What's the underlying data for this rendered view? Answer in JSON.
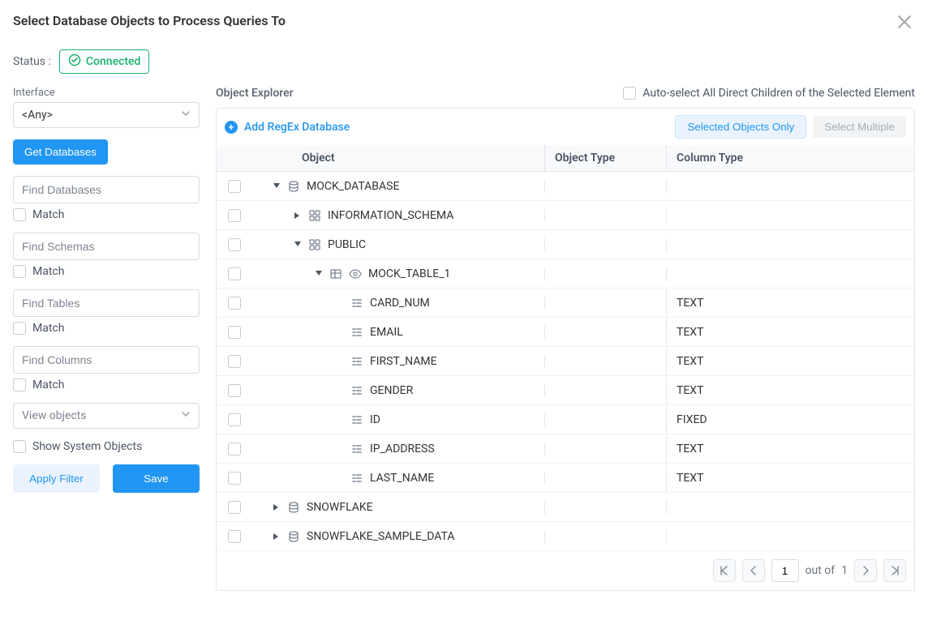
{
  "dialog": {
    "title": "Select Database Objects to Process Queries To"
  },
  "status": {
    "label": "Status :",
    "value": "Connected"
  },
  "sidebar": {
    "interface_label": "Interface",
    "interface_value": "<Any>",
    "get_databases": "Get Databases",
    "find_db_placeholder": "Find Databases",
    "find_schema_placeholder": "Find Schemas",
    "find_table_placeholder": "Find Tables",
    "find_column_placeholder": "Find Columns",
    "match_label": "Match",
    "view_objects": "View objects",
    "show_system_objects": "Show System Objects",
    "apply_filter": "Apply Filter",
    "save": "Save"
  },
  "explorer": {
    "title": "Object Explorer",
    "auto_select_label": "Auto-select All Direct Children of the Selected Element",
    "add_regex": "Add RegEx Database",
    "selected_only": "Selected Objects Only",
    "select_multiple": "Select Multiple",
    "columns": {
      "object": "Object",
      "object_type": "Object Type",
      "column_type": "Column Type"
    }
  },
  "rows": [
    {
      "level": 1,
      "expander": "down",
      "icon": "db",
      "name": "MOCK_DATABASE",
      "object_type": "",
      "column_type": ""
    },
    {
      "level": 2,
      "expander": "right",
      "icon": "schema",
      "name": "INFORMATION_SCHEMA",
      "object_type": "",
      "column_type": ""
    },
    {
      "level": 2,
      "expander": "down",
      "icon": "schema",
      "name": "PUBLIC",
      "object_type": "",
      "column_type": ""
    },
    {
      "level": 3,
      "expander": "down",
      "icon": "table_eye",
      "name": "MOCK_TABLE_1",
      "object_type": "",
      "column_type": ""
    },
    {
      "level": 4,
      "expander": "none",
      "icon": "col",
      "name": "CARD_NUM",
      "object_type": "",
      "column_type": "TEXT"
    },
    {
      "level": 4,
      "expander": "none",
      "icon": "col",
      "name": "EMAIL",
      "object_type": "",
      "column_type": "TEXT"
    },
    {
      "level": 4,
      "expander": "none",
      "icon": "col",
      "name": "FIRST_NAME",
      "object_type": "",
      "column_type": "TEXT"
    },
    {
      "level": 4,
      "expander": "none",
      "icon": "col",
      "name": "GENDER",
      "object_type": "",
      "column_type": "TEXT"
    },
    {
      "level": 4,
      "expander": "none",
      "icon": "col",
      "name": "ID",
      "object_type": "",
      "column_type": "FIXED"
    },
    {
      "level": 4,
      "expander": "none",
      "icon": "col",
      "name": "IP_ADDRESS",
      "object_type": "",
      "column_type": "TEXT"
    },
    {
      "level": 4,
      "expander": "none",
      "icon": "col",
      "name": "LAST_NAME",
      "object_type": "",
      "column_type": "TEXT"
    },
    {
      "level": 1,
      "expander": "right",
      "icon": "db",
      "name": "SNOWFLAKE",
      "object_type": "",
      "column_type": ""
    },
    {
      "level": 1,
      "expander": "right",
      "icon": "db",
      "name": "SNOWFLAKE_SAMPLE_DATA",
      "object_type": "",
      "column_type": ""
    }
  ],
  "pager": {
    "current": "1",
    "out_of": "out of",
    "total": "1"
  }
}
